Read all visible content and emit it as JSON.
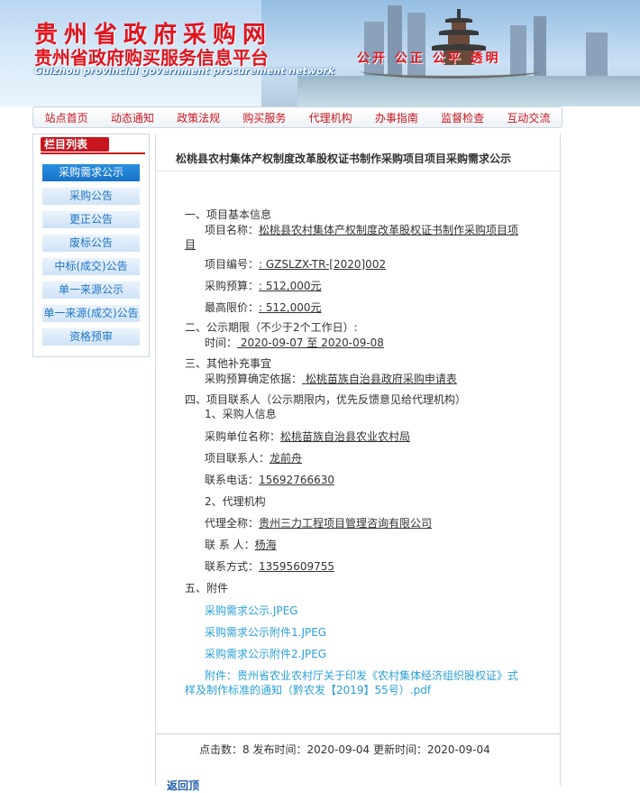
{
  "header": {
    "title": "贵州省政府采购网",
    "subtitle": "贵州省政府购买服务信息平台",
    "english": "Guizhou provincial government procurement network",
    "slogan": "公开  公正  公平  透明"
  },
  "nav": [
    "站点首页",
    "动态通知",
    "政策法规",
    "购买服务",
    "代理机构",
    "办事指南",
    "监督检查",
    "互动交流"
  ],
  "sidebar": {
    "heading": "栏目列表",
    "items": [
      "采购需求公示",
      "采购公告",
      "更正公告",
      "废标公告",
      "中标(成交)公告",
      "单一来源公示",
      "单一来源(成交)公告",
      "资格预审"
    ]
  },
  "article": {
    "title": "松桃县农村集体产权制度改革股权证书制作采购项目项目采购需求公示",
    "s1": "一、项目基本信息",
    "project_name_label": "项目名称：",
    "project_name_a": "松桃县农村集体产权制度改革股权证书制作采购项目项",
    "project_name_b": "目",
    "project_no_label": "项目编号：",
    "project_no": ": GZSLZX-TR-[2020]002",
    "budget_label": "采购预算：",
    "budget": ": 512,000元",
    "max_price_label": "最高限价：",
    "max_price": ": 512,000元",
    "s2": "二、公示期限（不少于2个工作日）:",
    "period_label": "时间：",
    "period": " 2020-09-07 至 2020-09-08",
    "s3": "三、其他补充事宜",
    "basis_label": "采购预算确定依据：",
    "basis": " 松桃苗族自治县政府采购申请表",
    "s4": "四、项目联系人（公示期限内，优先反馈意见给代理机构）",
    "s4_1": "1、采购人信息",
    "buyer_label": "采购单位名称：",
    "buyer": "松桃苗族自治县农业农村局",
    "buyer_contact_label": "项目联系人：",
    "buyer_contact": "龙前舟",
    "buyer_phone_label": "联系电话：",
    "buyer_phone": "15692766630",
    "s4_2": "2、代理机构",
    "agent_label": "代理全称：",
    "agent": "贵州三力工程项目管理咨询有限公司",
    "agent_contact_label": "联  系  人：",
    "agent_contact": "杨海",
    "agent_phone_label": "联系方式：",
    "agent_phone": "13595609755",
    "s5": "五、附件",
    "attachments": [
      "采购需求公示.JPEG",
      "采购需求公示附件1.JPEG",
      "采购需求公示附件2.JPEG"
    ],
    "attachment4_a": "附件：贵州省农业农村厅关于印发《农村集体经济组织股权证》式",
    "attachment4_b": "样及制作标准的通知（黔农发【2019】55号）.pdf"
  },
  "footer": {
    "stats": "点击数：8   发布时间：2020-09-04   更新时间：2020-09-04",
    "back": "返回顶"
  }
}
